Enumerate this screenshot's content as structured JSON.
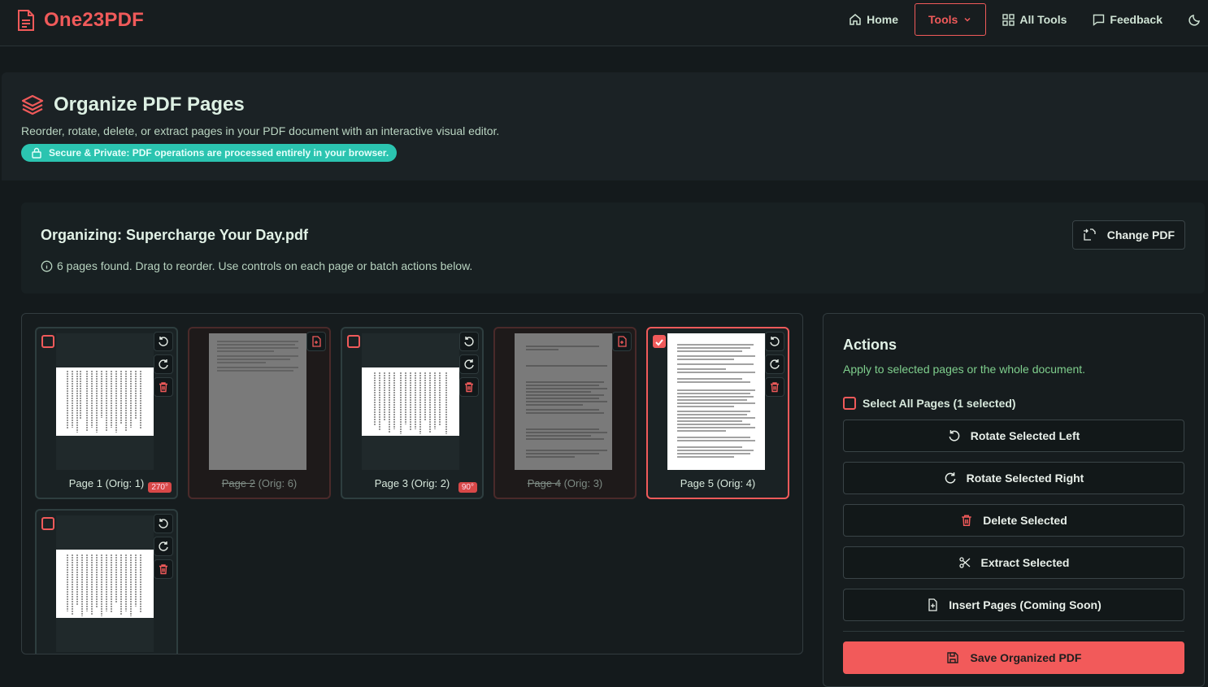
{
  "app": {
    "brand": "One23PDF"
  },
  "nav": {
    "home": "Home",
    "tools": "Tools",
    "all_tools": "All Tools",
    "feedback": "Feedback"
  },
  "header": {
    "title": "Organize PDF Pages",
    "subtitle": "Reorder, rotate, delete, or extract pages in your PDF document with an interactive visual editor.",
    "secure": "Secure & Private: PDF operations are processed entirely in your browser."
  },
  "organize": {
    "title": "Organizing: Supercharge Your Day.pdf",
    "info": "6 pages found. Drag to reorder. Use controls on each page or batch actions below.",
    "change_pdf": "Change PDF"
  },
  "pages": [
    {
      "label": "Page 1",
      "orig": "(Orig: 1)",
      "badge": "270°",
      "checked": false,
      "deleted": false
    },
    {
      "label": "Page 2",
      "orig": "(Orig: 6)",
      "badge": "",
      "checked": false,
      "deleted": true
    },
    {
      "label": "Page 3",
      "orig": "(Orig: 2)",
      "badge": "90°",
      "checked": false,
      "deleted": false
    },
    {
      "label": "Page 4",
      "orig": "(Orig: 3)",
      "badge": "",
      "checked": false,
      "deleted": true
    },
    {
      "label": "Page 5",
      "orig": "(Orig: 4)",
      "badge": "",
      "checked": true,
      "deleted": false
    },
    {
      "label": "",
      "orig": "",
      "badge": "",
      "checked": false,
      "deleted": false
    }
  ],
  "actions": {
    "title": "Actions",
    "subtitle": "Apply to selected pages or the whole document.",
    "select_all": "Select All Pages (1 selected)",
    "rotate_left": "Rotate Selected Left",
    "rotate_right": "Rotate Selected Right",
    "delete": "Delete Selected",
    "extract": "Extract Selected",
    "insert": "Insert Pages (Coming Soon)",
    "save": "Save Organized PDF"
  },
  "colors": {
    "accent": "#f05a5a",
    "teal": "#2bc4b0",
    "green_text": "#7fcf8d"
  }
}
